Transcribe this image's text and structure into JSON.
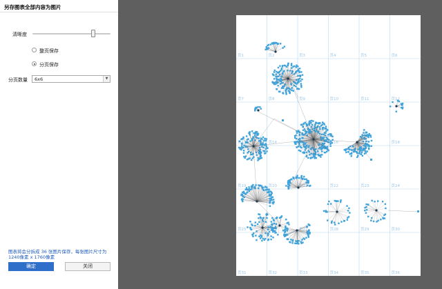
{
  "dialog": {
    "title": "另存图表全部内容为图片",
    "clarity_label": "清晰度",
    "clarity_level": 0.78,
    "radio_whole_page": "整页保存",
    "radio_paged": "分页保存",
    "selected_mode": "分页保存",
    "page_count_label": "分页数量",
    "page_count_value": "6x6",
    "info_text": "图表将会分拆成 36 张图片保存，每张图片尺寸为 1240像素 x 1760像素",
    "confirm_button": "确定",
    "close_button": "关闭"
  },
  "preview": {
    "page_labels": [
      "页1",
      "页2",
      "页3",
      "页4",
      "页5",
      "页6",
      "页7",
      "页8",
      "页9",
      "页10",
      "页11",
      "页12",
      "页13",
      "页14",
      "页15",
      "页16",
      "页17",
      "页18",
      "页19",
      "页20",
      "页21",
      "页22",
      "页23",
      "页24",
      "页25",
      "页26",
      "页27",
      "页28",
      "页29",
      "页30",
      "页31",
      "页32",
      "页33",
      "页34",
      "页35",
      "页36"
    ],
    "colors": {
      "node": "#3fa3dc",
      "grid": "#b7d7ee",
      "edge": "#666666",
      "page_label": "#9cc5e4"
    }
  }
}
